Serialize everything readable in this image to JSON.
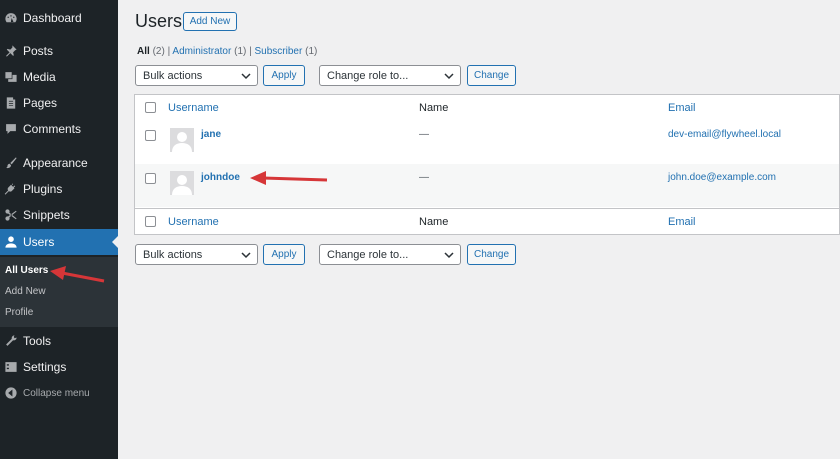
{
  "sidebar": {
    "items": [
      {
        "label": "Dashboard",
        "icon": "dashboard-icon"
      },
      {
        "label": "Posts",
        "icon": "pin-icon"
      },
      {
        "label": "Media",
        "icon": "media-icon"
      },
      {
        "label": "Pages",
        "icon": "pages-icon"
      },
      {
        "label": "Comments",
        "icon": "comment-icon"
      },
      {
        "label": "Appearance",
        "icon": "brush-icon"
      },
      {
        "label": "Plugins",
        "icon": "plug-icon"
      },
      {
        "label": "Snippets",
        "icon": "scissors-icon"
      },
      {
        "label": "Users",
        "icon": "user-icon"
      },
      {
        "label": "Tools",
        "icon": "wrench-icon"
      },
      {
        "label": "Settings",
        "icon": "settings-icon"
      }
    ],
    "submenu": [
      "All Users",
      "Add New",
      "Profile"
    ],
    "collapse_label": "Collapse menu"
  },
  "header": {
    "title": "Users",
    "add_new_label": "Add New"
  },
  "filters": {
    "all_label": "All",
    "all_count": "(2)",
    "administrator_label": "Administrator",
    "administrator_count": "(1)",
    "subscriber_label": "Subscriber",
    "subscriber_count": "(1)",
    "separator": "|"
  },
  "actions": {
    "bulk_actions": "Bulk actions",
    "apply_label": "Apply",
    "change_role": "Change role to...",
    "change_label": "Change"
  },
  "table": {
    "columns": [
      "Username",
      "Name",
      "Email"
    ],
    "rows": [
      {
        "username": "jane",
        "name": "—",
        "email": "dev-email@flywheel.local"
      },
      {
        "username": "johndoe",
        "name": "—",
        "email": "john.doe@example.com"
      }
    ]
  },
  "colors": {
    "accent": "#2271b1",
    "sidebar_bg": "#1d2327",
    "arrow": "#d63638"
  }
}
